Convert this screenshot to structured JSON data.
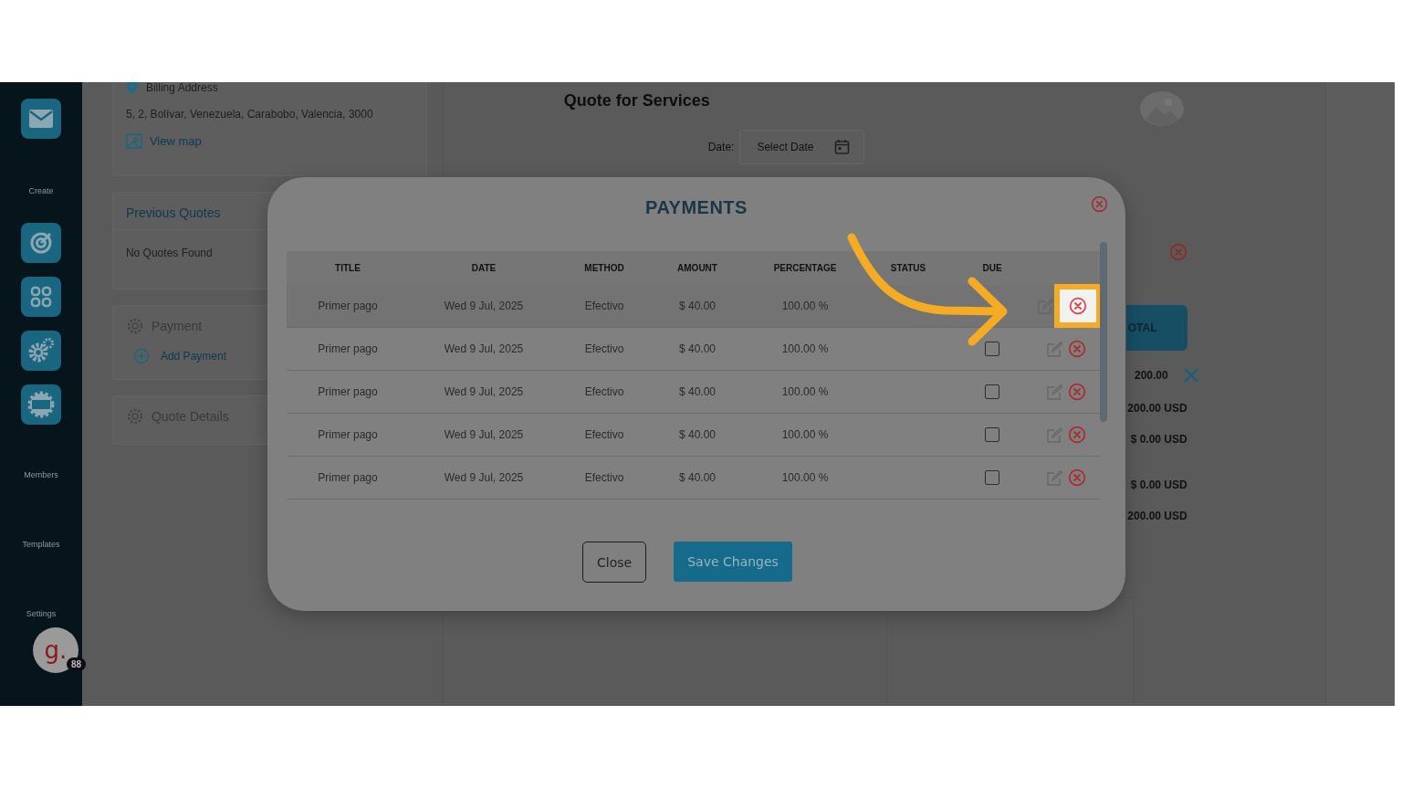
{
  "sidebar": {
    "create_label": "Create",
    "section_labels": [
      "Members",
      "Templates",
      "Settings"
    ],
    "avatar": {
      "letter": "g.",
      "badge": "88"
    }
  },
  "billing": {
    "heading": "Billing Address",
    "address": "5, 2, Bolívar, Venezuela, Carabobo, Valencia, 3000",
    "link": "View map"
  },
  "previous_quotes": {
    "title": "Previous Quotes",
    "empty_text": "No Quotes Found"
  },
  "payment_card": {
    "title": "Payment",
    "action": "Add Payment"
  },
  "quote_details": {
    "title": "Quote Details"
  },
  "quote": {
    "title": "Quote for Services",
    "date_label": "Date:",
    "date_placeholder": "Select Date",
    "total_header": "OTAL",
    "amount": "200.00",
    "totals": [
      "200.00 USD",
      "$ 0.00 USD",
      "$ 0.00 USD",
      "200.00 USD"
    ]
  },
  "modal": {
    "title": "PAYMENTS",
    "columns": [
      "TITLE",
      "DATE",
      "METHOD",
      "AMOUNT",
      "PERCENTAGE",
      "STATUS",
      "DUE"
    ],
    "rows": [
      {
        "title": "Primer pago",
        "date": "Wed 9 Jul, 2025",
        "method": "Efectivo",
        "amount": "$ 40.00",
        "percentage": "100.00 %",
        "selected": true,
        "highlighted": true
      },
      {
        "title": "Primer pago",
        "date": "Wed 9 Jul, 2025",
        "method": "Efectivo",
        "amount": "$ 40.00",
        "percentage": "100.00 %",
        "due_checked": false,
        "selected": false,
        "highlighted": false
      },
      {
        "title": "Primer pago",
        "date": "Wed 9 Jul, 2025",
        "method": "Efectivo",
        "amount": "$ 40.00",
        "percentage": "100.00 %",
        "due_checked": false,
        "selected": false,
        "highlighted": false
      },
      {
        "title": "Primer pago",
        "date": "Wed 9 Jul, 2025",
        "method": "Efectivo",
        "amount": "$ 40.00",
        "percentage": "100.00 %",
        "due_checked": false,
        "selected": false,
        "highlighted": false
      },
      {
        "title": "Primer pago",
        "date": "Wed 9 Jul, 2025",
        "method": "Efectivo",
        "amount": "$ 40.00",
        "percentage": "100.00 %",
        "due_checked": false,
        "selected": false,
        "highlighted": false
      }
    ],
    "buttons": {
      "close": "Close",
      "save": "Save Changes"
    }
  }
}
